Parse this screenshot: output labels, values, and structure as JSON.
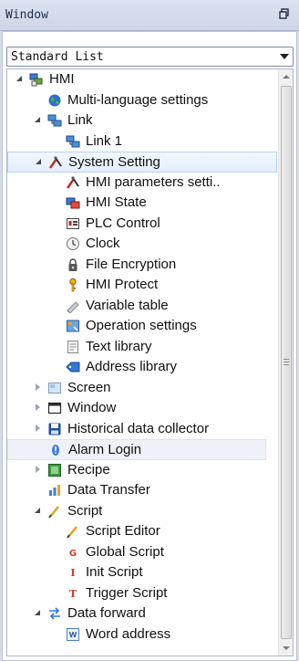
{
  "window": {
    "title": "Window",
    "pin_glyph": "ɐ"
  },
  "dropdown": {
    "selected": "Standard List",
    "icon": "chevron-down-icon"
  },
  "tree": {
    "items": [
      {
        "label": "HMI",
        "level": 0,
        "expand": "open",
        "icon": "hmi-icon"
      },
      {
        "label": "Multi-language settings",
        "level": 1,
        "expand": "",
        "icon": "globe-icon"
      },
      {
        "label": "Link",
        "level": 1,
        "expand": "open",
        "icon": "link-icon"
      },
      {
        "label": "Link 1",
        "level": 2,
        "expand": "",
        "icon": "link-icon"
      },
      {
        "label": "System Setting",
        "level": 1,
        "expand": "open",
        "icon": "tools-icon",
        "selected": true
      },
      {
        "label": "HMI parameters setti..",
        "level": 2,
        "expand": "",
        "icon": "tools-icon"
      },
      {
        "label": "HMI State",
        "level": 2,
        "expand": "",
        "icon": "hmi-state-icon"
      },
      {
        "label": "PLC Control",
        "level": 2,
        "expand": "",
        "icon": "plc-icon"
      },
      {
        "label": "Clock",
        "level": 2,
        "expand": "",
        "icon": "clock-icon"
      },
      {
        "label": "File Encryption",
        "level": 2,
        "expand": "",
        "icon": "lock-icon"
      },
      {
        "label": "HMI Protect",
        "level": 2,
        "expand": "",
        "icon": "key-icon"
      },
      {
        "label": "Variable table",
        "level": 2,
        "expand": "",
        "icon": "pencil-icon"
      },
      {
        "label": "Operation settings",
        "level": 2,
        "expand": "",
        "icon": "operation-icon"
      },
      {
        "label": "Text library",
        "level": 2,
        "expand": "",
        "icon": "text-library-icon"
      },
      {
        "label": "Address library",
        "level": 2,
        "expand": "",
        "icon": "address-library-icon"
      },
      {
        "label": "Screen",
        "level": 1,
        "expand": "closed",
        "icon": "screen-icon"
      },
      {
        "label": "Window",
        "level": 1,
        "expand": "closed",
        "icon": "window-icon"
      },
      {
        "label": "Historical data collector",
        "level": 1,
        "expand": "closed",
        "icon": "save-icon"
      },
      {
        "label": "Alarm Login",
        "level": 1,
        "expand": "",
        "icon": "alarm-icon",
        "hover": true
      },
      {
        "label": "Recipe",
        "level": 1,
        "expand": "closed",
        "icon": "recipe-icon"
      },
      {
        "label": "Data Transfer",
        "level": 1,
        "expand": "",
        "icon": "data-transfer-icon"
      },
      {
        "label": "Script",
        "level": 1,
        "expand": "open",
        "icon": "script-icon"
      },
      {
        "label": "Script Editor",
        "level": 2,
        "expand": "",
        "icon": "script-icon"
      },
      {
        "label": "Global Script",
        "level": 2,
        "expand": "",
        "icon": "global-script-icon"
      },
      {
        "label": "Init Script",
        "level": 2,
        "expand": "",
        "icon": "init-script-icon"
      },
      {
        "label": "Trigger Script",
        "level": 2,
        "expand": "",
        "icon": "trigger-script-icon"
      },
      {
        "label": "Data forward",
        "level": 1,
        "expand": "open",
        "icon": "data-forward-icon"
      },
      {
        "label": "Word address",
        "level": 2,
        "expand": "",
        "icon": "word-address-icon"
      }
    ]
  }
}
